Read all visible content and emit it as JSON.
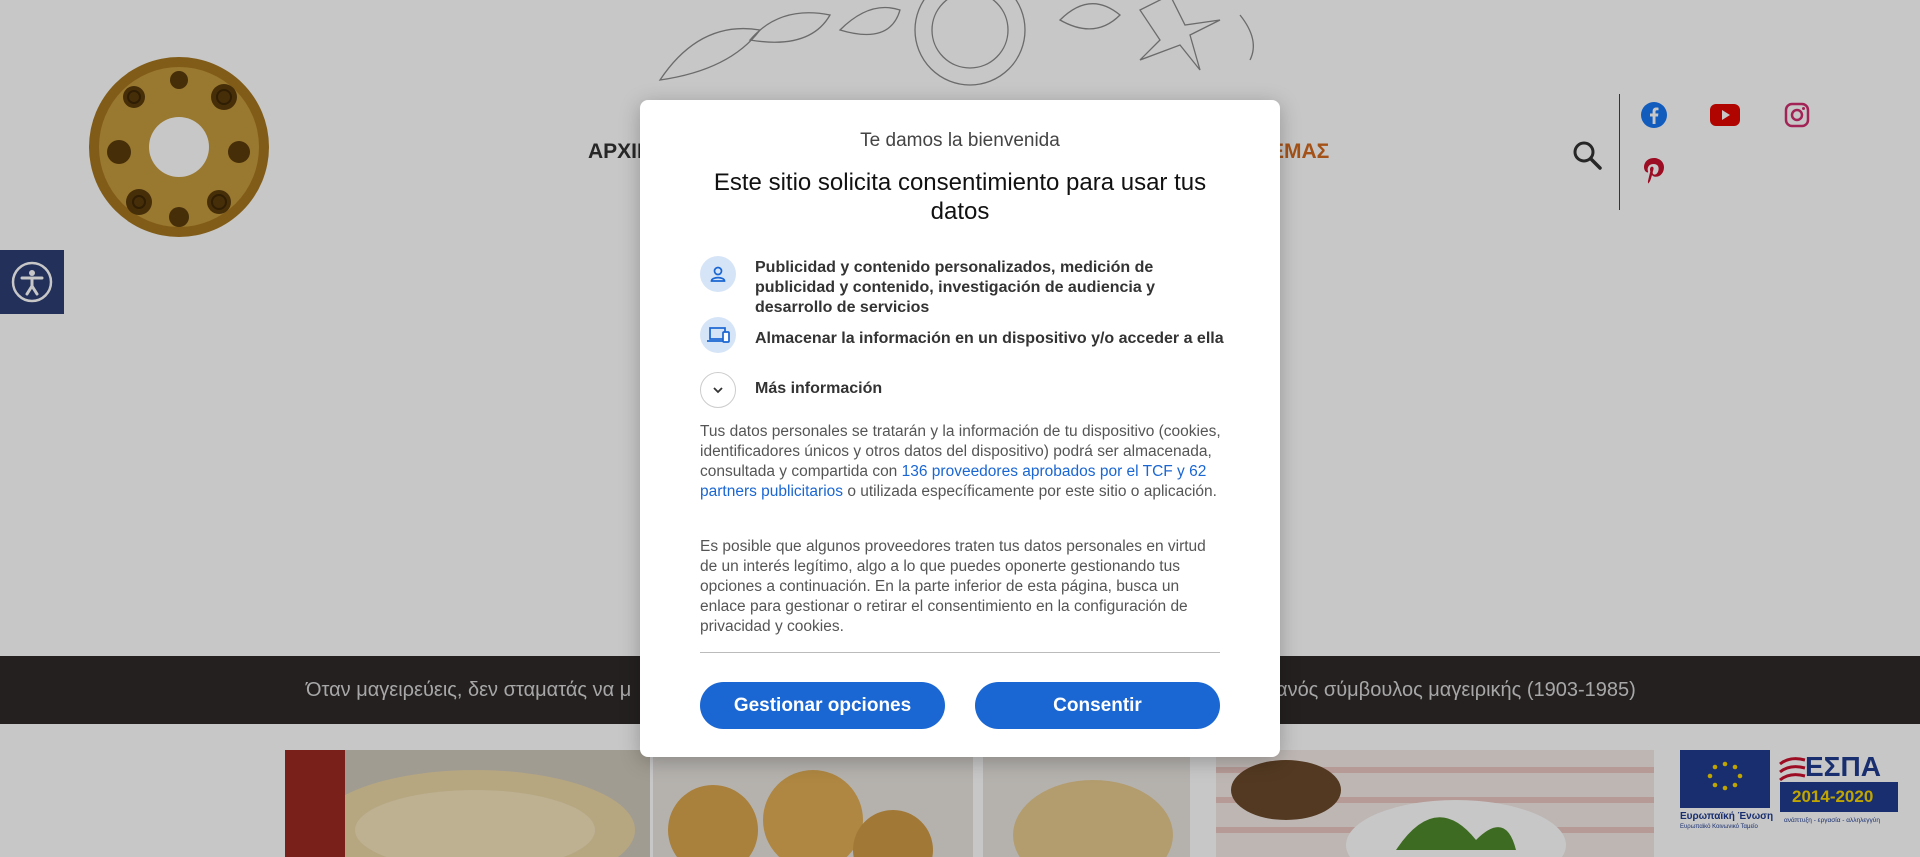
{
  "header": {
    "nav_left": "ΑΡΧΙΚ",
    "nav_right": "ΕΜΑΣ",
    "icons": {
      "logo": "decorative-wreath-logo",
      "search": "search-icon",
      "facebook": "facebook-icon",
      "youtube": "youtube-icon",
      "instagram": "instagram-icon",
      "pinterest": "pinterest-icon",
      "accessibility": "accessibility-icon"
    },
    "colors": {
      "facebook": "#1877f2",
      "youtube": "#e10600",
      "instagram": "#d02d6e",
      "pinterest": "#c8102e"
    }
  },
  "quote": {
    "left": "Όταν μαγειρεύεις, δεν σταματάς να μ",
    "right": "ανός σύμβουλος μαγειρικής (1903-1985)"
  },
  "banner": {
    "eu_label": "Ευρωπαϊκή Ένωση",
    "eu_sub": "Ευρωπαϊκό Κοινωνικό Ταμείο",
    "espa_title": "ΕΣΠΑ",
    "espa_years": "2014-2020",
    "espa_sub": "ανάπτυξη - εργασία - αλληλεγγύη"
  },
  "consent": {
    "welcome": "Te damos la bienvenida",
    "headline": "Este sitio solicita consentimiento para usar tus datos",
    "purposes": [
      {
        "icon": "person-icon",
        "text": "Publicidad y contenido personalizados, medición de publicidad y contenido, investigación de audiencia y desarrollo de servicios"
      },
      {
        "icon": "devices-icon",
        "text": "Almacenar la información en un dispositivo y/o acceder a ella"
      }
    ],
    "more_info": "Más información",
    "para1_pre": "Tus datos personales se tratarán y la información de tu dispositivo (cookies, identificadores únicos y otros datos del dispositivo) podrá ser almacenada, consultada y compartida con ",
    "para1_link": "136 proveedores aprobados por el TCF y 62 partners publicitarios",
    "para1_post": " o utilizada específicamente por este sitio o aplicación.",
    "para2": "Es posible que algunos proveedores traten tus datos personales en virtud de un interés legítimo, algo a lo que puedes oponerte gestionando tus opciones a continuación. En la parte inferior de esta página, busca un enlace para gestionar o retirar el consentimiento en la configuración de privacidad y cookies.",
    "manage_button": "Gestionar opciones",
    "consent_button": "Consentir",
    "accent_color": "#1a66d2"
  }
}
